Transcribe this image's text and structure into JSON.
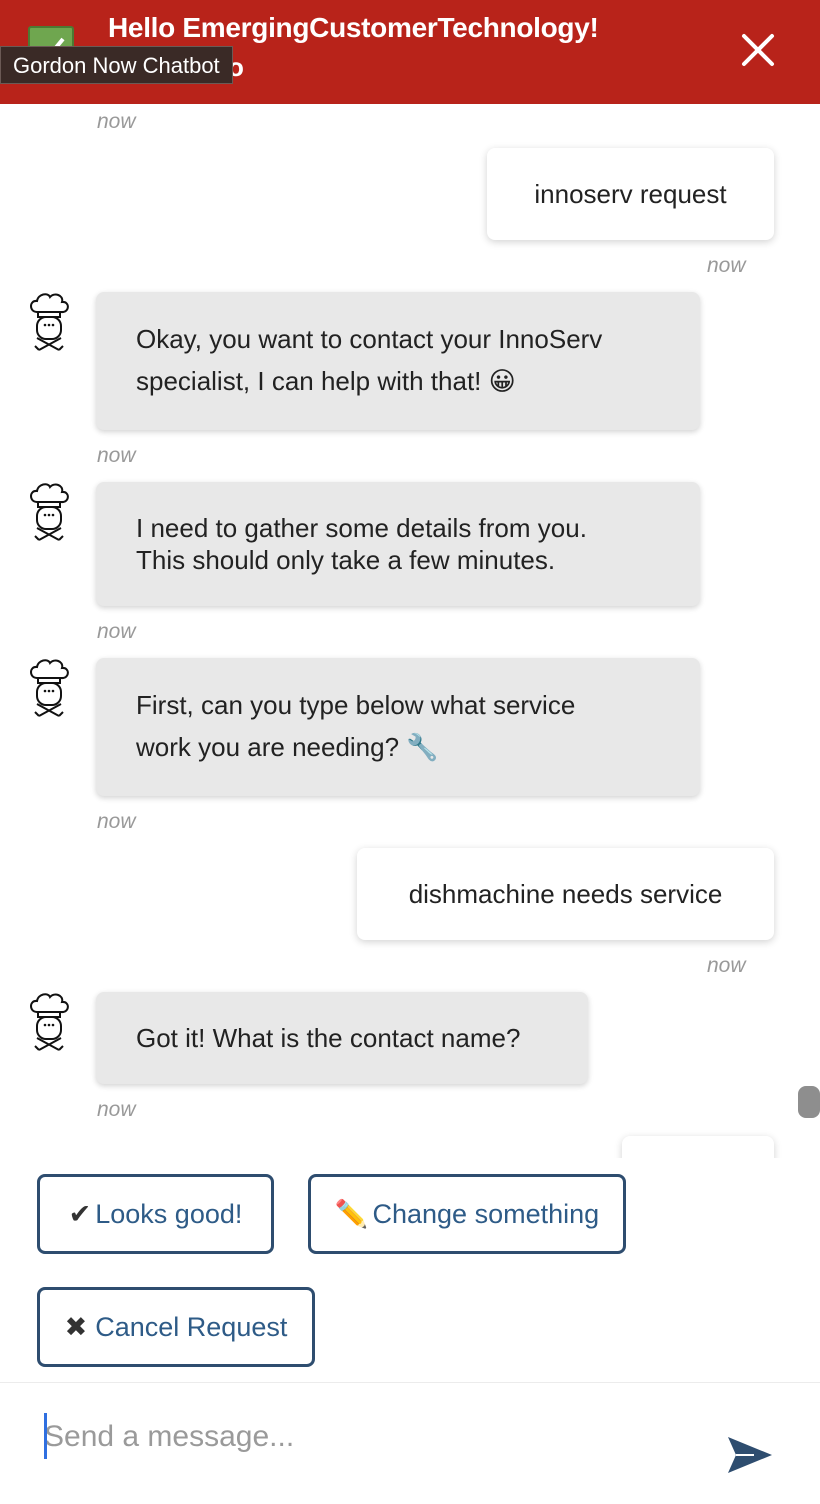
{
  "header": {
    "title": "Hello EmergingCustomerTechnology!",
    "subtitle_fragment": "o",
    "tooltip": "Gordon Now Chatbot",
    "logo_icon": "checkmark-logo-icon",
    "close_icon": "close-icon"
  },
  "messages": [
    {
      "sender": "user",
      "text": "innoserv request",
      "time": "now"
    },
    {
      "sender": "bot",
      "line1": "Okay, you want to contact your InnoServ",
      "line2": "specialist, I can help with that!",
      "emoji": "😀",
      "time": "now"
    },
    {
      "sender": "bot",
      "line1": "I need to gather some details from you.",
      "line2": "This should only take a few minutes.",
      "time": "now"
    },
    {
      "sender": "bot",
      "line1": "First, can you type below what service",
      "line2": "work you are needing?",
      "emoji": "🔧",
      "time": "now"
    },
    {
      "sender": "user",
      "text": "dishmachine needs service",
      "time": "now"
    },
    {
      "sender": "bot",
      "text": "Got it! What is the contact name?",
      "time": "now"
    }
  ],
  "top_timestamp": "now",
  "quick_replies": [
    {
      "symbol": "✔",
      "label": "Looks good!"
    },
    {
      "symbol": "✏️",
      "label": "Change something"
    },
    {
      "symbol": "✖",
      "label": "Cancel Request"
    }
  ],
  "composer": {
    "placeholder": "Send a message...",
    "send_icon": "send-icon"
  },
  "colors": {
    "header_bg": "#b8231a",
    "button_border": "#2e4d6f",
    "button_text": "#2e5b87",
    "bot_bubble": "#e8e8e8"
  }
}
